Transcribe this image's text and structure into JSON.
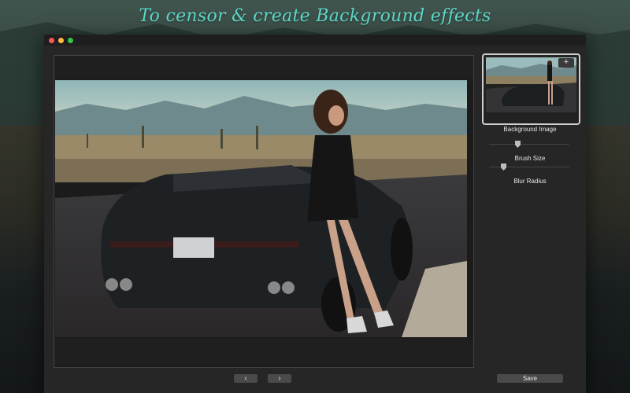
{
  "tagline": "To censor & create Background effects",
  "window": {
    "controls": [
      "close",
      "minimize",
      "zoom"
    ]
  },
  "canvas": {
    "photo_description_icon": "photo-canvas"
  },
  "navigation": {
    "prev_label": "‹",
    "next_label": "›"
  },
  "panel": {
    "thumbnail_add_label": "+",
    "background_image_label": "Background Image",
    "brush_size": {
      "label": "Brush Size",
      "value": 0.35
    },
    "blur_radius": {
      "label": "Blur Radius",
      "value": 0.16
    },
    "save_label": "Save"
  },
  "colors": {
    "tagline": "#5fd8c8",
    "window_bg": "#262626",
    "button_bg": "#4a4a4a",
    "close": "#fc5753",
    "minimize": "#fdbc40",
    "zoom": "#33c748"
  }
}
